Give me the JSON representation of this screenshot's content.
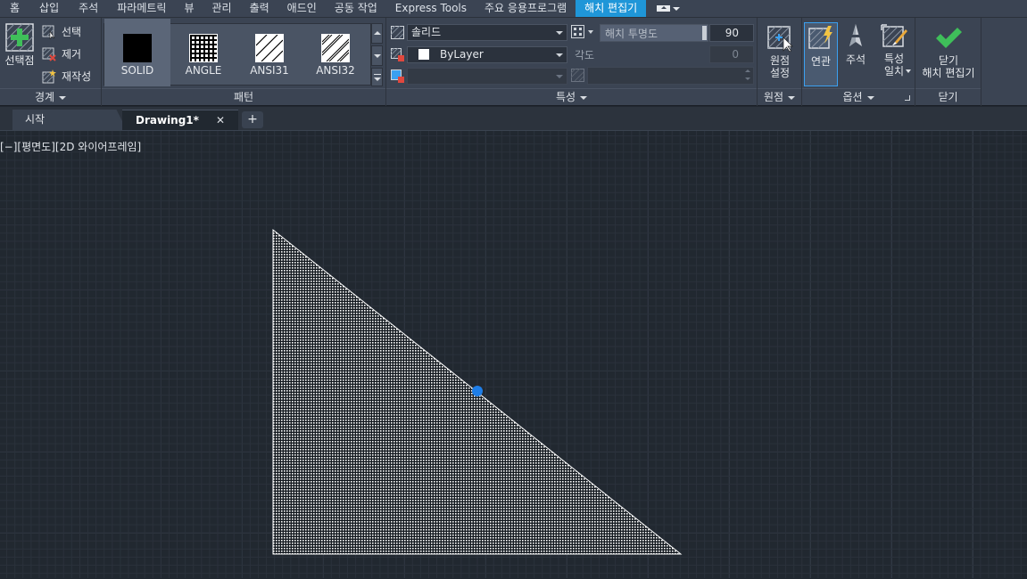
{
  "menu": {
    "tabs": [
      "홈",
      "삽입",
      "주석",
      "파라메트릭",
      "뷰",
      "관리",
      "출력",
      "애드인",
      "공동 작업",
      "Express Tools",
      "주요 응용프로그램",
      "해치 편집기"
    ],
    "active_tab": "해치 편집기"
  },
  "ribbon": {
    "boundary": {
      "title": "경계",
      "pick_points": "선택점",
      "select": "선택",
      "remove": "제거",
      "recreate": "재작성"
    },
    "pattern": {
      "title": "패턴",
      "items": [
        "SOLID",
        "ANGLE",
        "ANSI31",
        "ANSI32"
      ]
    },
    "properties": {
      "title": "특성",
      "hatch_type": "솔리드",
      "color": "ByLayer",
      "background_color": "",
      "transparency_label": "해치 투명도",
      "transparency_value": "90",
      "angle_label": "각도",
      "angle_value": "0"
    },
    "origin": {
      "title": "원점",
      "set_origin": "원점\n설정"
    },
    "options": {
      "title": "옵션",
      "associative": "연관",
      "annotative": "주석",
      "match_properties": "특성\n일치"
    },
    "close": {
      "title": "닫기",
      "close_editor": "닫기\n해치 편집기"
    }
  },
  "doc_tabs": {
    "start": "시작",
    "drawing": "Drawing1*",
    "close_glyph": "✕",
    "add_glyph": "+"
  },
  "viewport": {
    "control": "[−]",
    "view": "[평면도]",
    "visual_style": "[2D 와이어프레임]"
  },
  "colors": {
    "accent": "#1f96d8",
    "grip": "#1e7ee8",
    "hatch": "#ffffff",
    "close_check": "#3fbf5a"
  }
}
